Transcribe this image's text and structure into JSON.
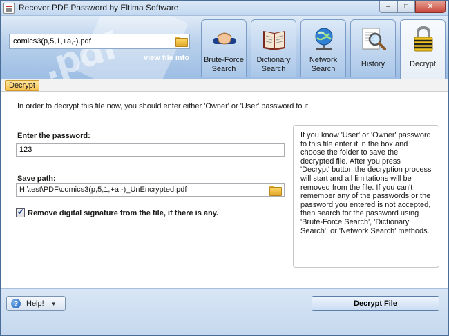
{
  "window": {
    "title": "Recover PDF Password by Eltima Software",
    "controls": {
      "minimize": "–",
      "maximize": "□",
      "close": "✕"
    }
  },
  "header": {
    "file_name": "comics3(p,5,1,+a,-).pdf",
    "view_file_info": "view file info",
    "watermark": ".pdf"
  },
  "tabs": [
    {
      "label": "Brute-Force Search",
      "icon": "handshake-icon"
    },
    {
      "label": "Dictionary Search",
      "icon": "book-icon"
    },
    {
      "label": "Network Search",
      "icon": "network-globe-icon"
    },
    {
      "label": "History",
      "icon": "magnifier-icon"
    },
    {
      "label": "Decrypt",
      "icon": "padlock-icon",
      "active": true
    }
  ],
  "section": {
    "label": "Decrypt"
  },
  "main": {
    "intro": "In order to decrypt this file now, you should enter either 'Owner' or 'User' password to it.",
    "password_label": "Enter the password:",
    "password_value": "123",
    "save_label": "Save path:",
    "save_path": "H:\\test\\PDF\\comics3(p,5,1,+a,-)_UnEncrypted.pdf",
    "remove_signature_label": "Remove digital signature from the file, if there is any.",
    "remove_signature_checked": true,
    "help_text": "If you know 'User' or 'Owner' password to this file enter it in the box and choose the folder to save the decrypted file. After you press 'Decrypt' button the decryption process will start and all limitations will be removed from the file. If you can't remember any of the passwords or the password you entered is not accepted, then search for the password using 'Brute-Force Search', 'Dictionary Search', or 'Network Search' methods."
  },
  "footer": {
    "help_label": "Help!",
    "decrypt_button": "Decrypt File"
  }
}
